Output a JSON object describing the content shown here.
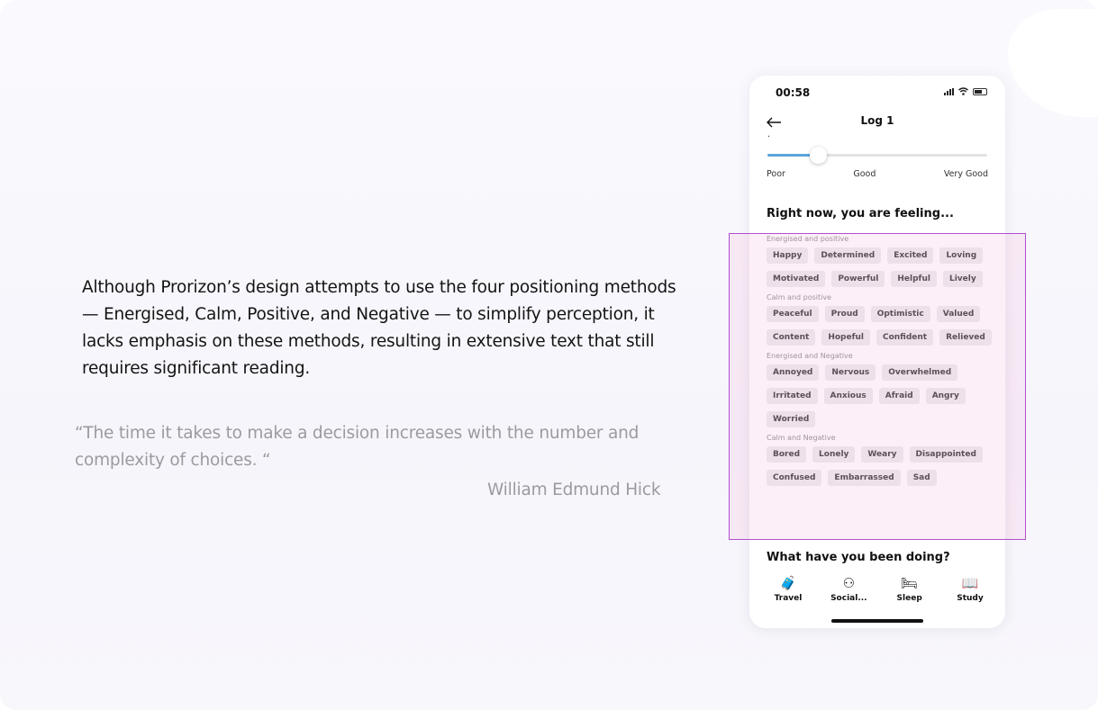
{
  "article": {
    "body": "Although Prorizon’s design attempts to use the four positioning methods — Energised, Calm, Positive, and Negative — to simplify perception, it lacks emphasis on these methods, resulting in extensive text that still requires significant reading.",
    "quote": "“The time it takes to make a decision increases with the number and complexity of choices. “",
    "author": "William Edmund Hick"
  },
  "phone": {
    "time": "00:58",
    "title": "Log 1",
    "dot": ".",
    "slider": {
      "value_fraction": 0.23,
      "labels": [
        "Poor",
        "Good",
        "Very Good"
      ]
    },
    "feeling_title": "Right now, you are feeling...",
    "groups": [
      {
        "label": "Energised and positive",
        "chips": [
          "Happy",
          "Determined",
          "Excited",
          "Loving",
          "Motivated",
          "Powerful",
          "Helpful",
          "Lively"
        ]
      },
      {
        "label": "Calm and positive",
        "chips": [
          "Peaceful",
          "Proud",
          "Optimistic",
          "Valued",
          "Content",
          "Hopeful",
          "Confident",
          "Relieved"
        ]
      },
      {
        "label": "Energised and Negative",
        "chips": [
          "Annoyed",
          "Nervous",
          "Overwhelmed",
          "Irritated",
          "Anxious",
          "Afraid",
          "Angry",
          "Worried"
        ]
      },
      {
        "label": "Calm and Negative",
        "chips": [
          "Bored",
          "Lonely",
          "Weary",
          "Disappointed",
          "Confused",
          "Embarrassed",
          "Sad"
        ]
      }
    ],
    "doing_title": "What have you been doing?",
    "activities": [
      {
        "label": "Travel",
        "icon": "suitcase-icon",
        "glyph": "🧳"
      },
      {
        "label": "Social...",
        "icon": "social-icon",
        "glyph": "⚇"
      },
      {
        "label": "Sleep",
        "icon": "bed-icon",
        "glyph": "🛏"
      },
      {
        "label": "Study",
        "icon": "study-icon",
        "glyph": "📖"
      }
    ]
  },
  "colors": {
    "slider_fill": "#5ba5db",
    "highlight_border": "#b04fcf"
  }
}
